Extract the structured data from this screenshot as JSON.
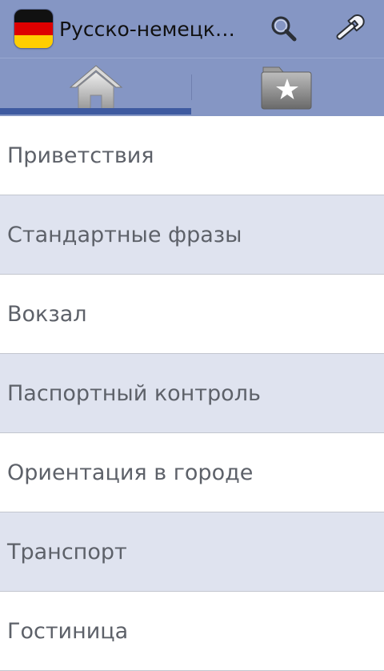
{
  "app": {
    "title": "Русско-немецкий разговорник",
    "icon": "germany-flag-icon",
    "flag_colors": [
      "#111111",
      "#dd0000",
      "#ffce00"
    ]
  },
  "actions": {
    "search_icon": "search-icon",
    "settings_icon": "wrench-icon"
  },
  "tabs": [
    {
      "icon": "home-icon",
      "selected": true
    },
    {
      "icon": "favorites-folder-icon",
      "selected": false
    }
  ],
  "colors": {
    "actionbar": "#8596c4",
    "tab_indicator": "#3e5aa0",
    "row_alt": "#dfe3ef",
    "row_text": "#5d6169"
  },
  "categories": [
    {
      "label": "Приветствия"
    },
    {
      "label": "Стандартные фразы"
    },
    {
      "label": "Вокзал"
    },
    {
      "label": "Паспортный контроль"
    },
    {
      "label": "Ориентация в городе"
    },
    {
      "label": "Транспорт"
    },
    {
      "label": "Гостиница"
    }
  ]
}
